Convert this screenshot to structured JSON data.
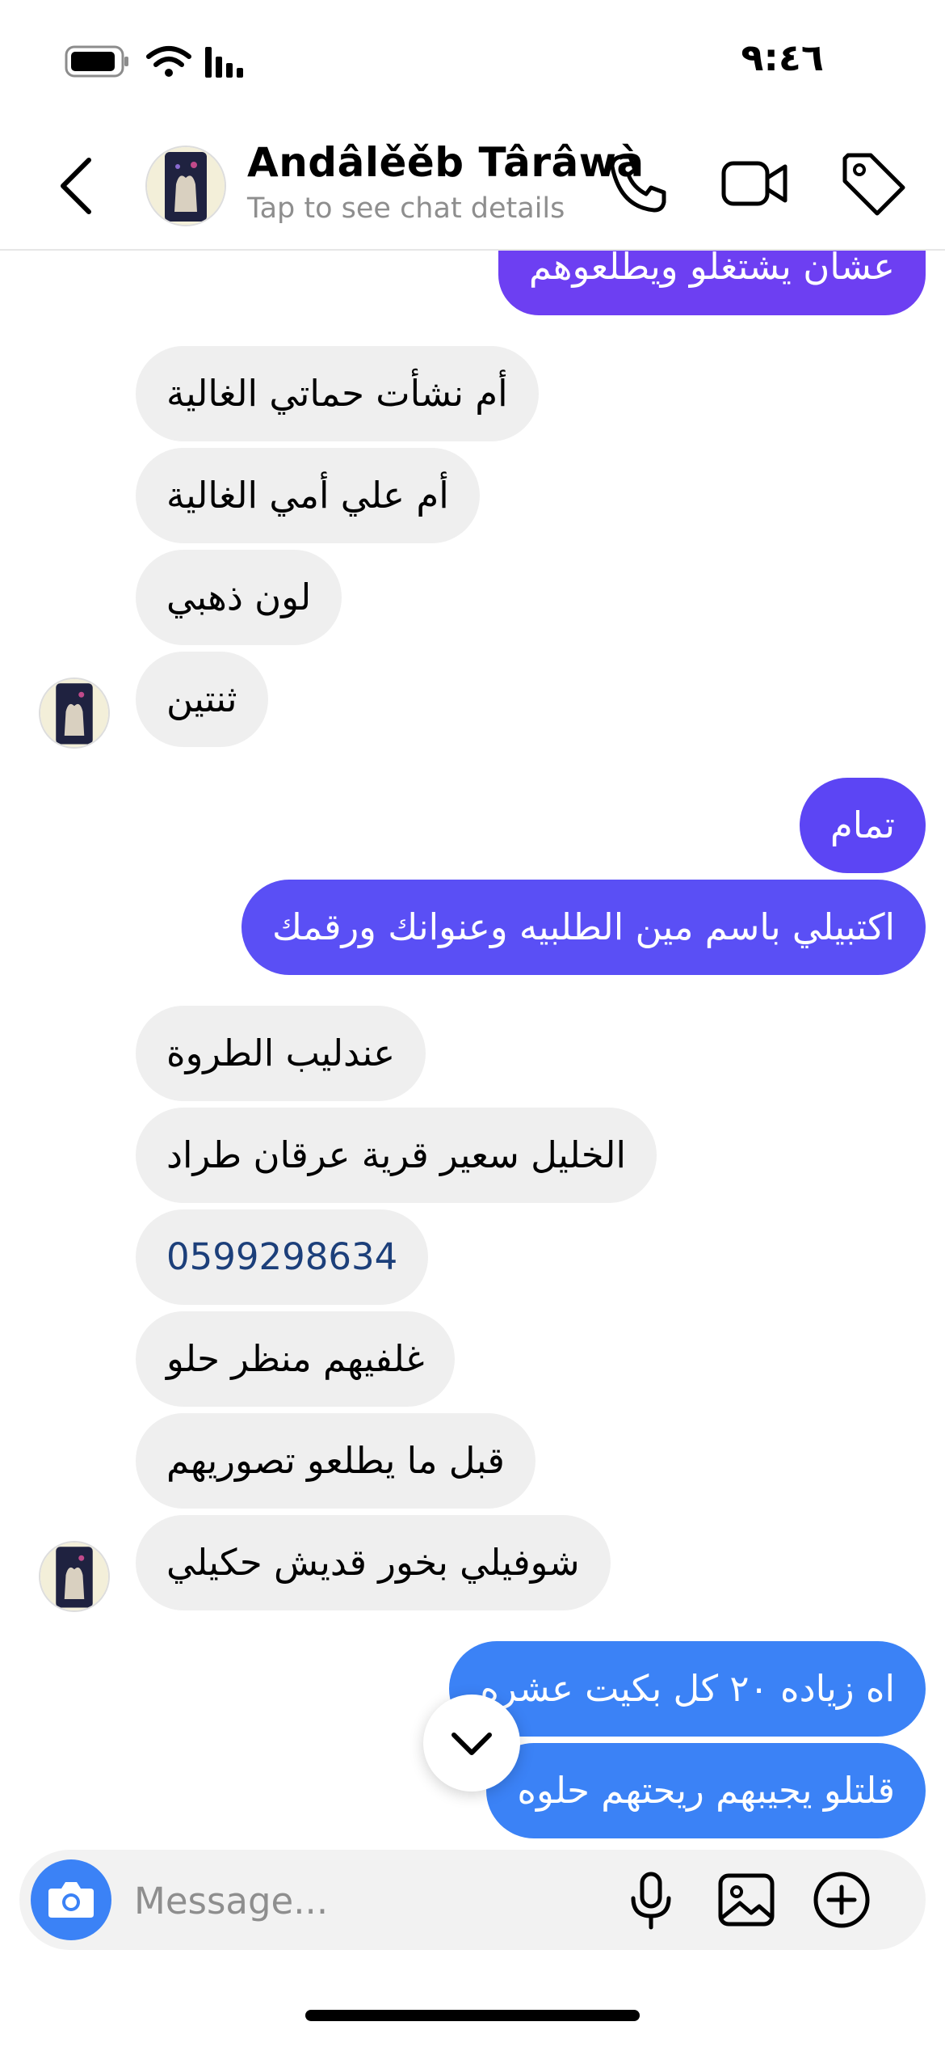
{
  "status_bar": {
    "time": "٩:٤٦"
  },
  "header": {
    "contact_name": "Andâlěěb Târâwà",
    "subtitle": "Tap to see chat details",
    "icons": [
      "back-icon",
      "phone-icon",
      "video-icon",
      "tag-icon"
    ]
  },
  "messages": [
    {
      "side": "out",
      "text": "عشان يشتغلو ويطلعوهم"
    },
    {
      "side": "in",
      "text": "أم نشأت حماتي الغالية"
    },
    {
      "side": "in",
      "text": "أم علي أمي الغالية"
    },
    {
      "side": "in",
      "text": "لون ذهبي"
    },
    {
      "side": "in",
      "text": "ثنتين"
    },
    {
      "side": "out",
      "text": "تمام"
    },
    {
      "side": "out",
      "text": "اكتبيلي باسم مين الطلبيه وعنوانك ورقمك"
    },
    {
      "side": "in",
      "text": "عندليب الطروة"
    },
    {
      "side": "in",
      "text": "الخليل سعير قرية عرقان طراد"
    },
    {
      "side": "in",
      "text": "0599298634"
    },
    {
      "side": "in",
      "text": "غلفيهم منظر حلو"
    },
    {
      "side": "in",
      "text": "قبل ما يطلعو تصوريهم"
    },
    {
      "side": "in",
      "text": "شوفيلي بخور قديش حكيلي"
    },
    {
      "side": "out",
      "text": "اه  زياده ٢٠ كل بكيت عشره"
    },
    {
      "side": "out",
      "text": "قلتلو يجيبهم ريحتهم حلوه"
    }
  ],
  "composer": {
    "placeholder": "Message..."
  },
  "colors": {
    "bubble_in": "#efefef",
    "bubble_out_purple": "#6d3ff2",
    "bubble_out_indigo": "#5a4ff5",
    "bubble_out_blue": "#3b82f6",
    "phone_link": "#1c3f7a"
  }
}
